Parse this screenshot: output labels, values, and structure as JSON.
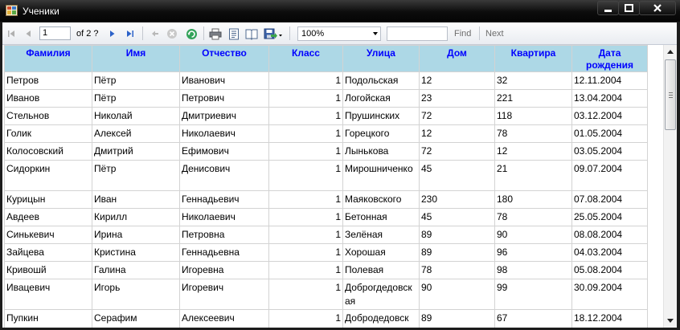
{
  "window": {
    "title": "Ученики"
  },
  "toolbar": {
    "page_current": "1",
    "page_of": "of  2 ?",
    "zoom": "100%",
    "search_value": "",
    "find_label": "Find",
    "next_label": "Next"
  },
  "table": {
    "columns": [
      "Фамилия",
      "Имя",
      "Отчество",
      "Класс",
      "Улица",
      "Дом",
      "Квартира",
      "Дата рождения"
    ],
    "rows": [
      [
        "Петров",
        "Пётр",
        "Иванович",
        "1",
        "Подольская",
        "12",
        "32",
        "12.11.2004"
      ],
      [
        "Иванов",
        "Пётр",
        "Петрович",
        "1",
        "Логойская",
        "23",
        "221",
        "13.04.2004"
      ],
      [
        "Стельнов",
        "Николай",
        "Дмитриевич",
        "1",
        "Прушинских",
        "72",
        "118",
        "03.12.2004"
      ],
      [
        "Голик",
        "Алексей",
        "Николаевич",
        "1",
        "Горецкого",
        "12",
        "78",
        "01.05.2004"
      ],
      [
        "Колосовский",
        "Дмитрий",
        "Ефимович",
        "1",
        "Лынькова",
        "72",
        "12",
        "03.05.2004"
      ],
      [
        "Сидоркин",
        "Пётр",
        "Денисович",
        "1",
        "Мирошниченко",
        "45",
        "21",
        "09.07.2004"
      ],
      [
        "Курицын",
        "Иван",
        "Геннадьевич",
        "1",
        "Маяковского",
        "230",
        "180",
        "07.08.2004"
      ],
      [
        "Авдеев",
        "Кирилл",
        "Николаевич",
        "1",
        "Бетонная",
        "45",
        "78",
        "25.05.2004"
      ],
      [
        "Синькевич",
        "Ирина",
        "Петровна",
        "1",
        "Зелёная",
        "89",
        "90",
        "08.08.2004"
      ],
      [
        "Зайцева",
        "Кристина",
        "Геннадьевна",
        "1",
        "Хорошая",
        "89",
        "96",
        "04.03.2004"
      ],
      [
        "Кривошй",
        "Галина",
        "Игоревна",
        "1",
        "Полевая",
        "78",
        "98",
        "05.08.2004"
      ],
      [
        "Ивацевич",
        "Игорь",
        "Игоревич",
        "1",
        "Доброгдедовская",
        "90",
        "99",
        "30.09.2004"
      ],
      [
        "Пупкин",
        "Серафим",
        "Алексеевич",
        "1",
        "Добродедовск",
        "89",
        "67",
        "18.12.2004"
      ]
    ]
  },
  "colors": {
    "header_bg": "#add8e6",
    "header_text": "#0000ff",
    "grid_line": "#d3d3d3"
  }
}
